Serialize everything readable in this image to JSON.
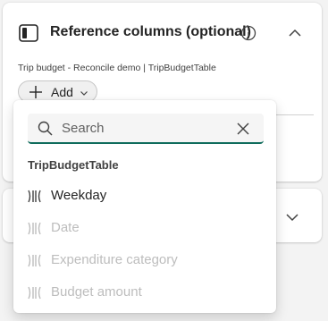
{
  "section": {
    "title": "Reference columns (optional)",
    "source_label": "Trip budget - Reconcile demo | TripBudgetTable",
    "add_button_label": "Add"
  },
  "dropdown": {
    "search_placeholder": "Search",
    "group_header": "TripBudgetTable",
    "options": [
      {
        "label": "Weekday",
        "enabled": true
      },
      {
        "label": "Date",
        "enabled": false
      },
      {
        "label": "Expenditure category",
        "enabled": false
      },
      {
        "label": "Budget amount",
        "enabled": false
      }
    ]
  },
  "colors": {
    "accent": "#0f6c5c",
    "text": "#242424",
    "disabled_text": "#bdbdbd",
    "background": "#f3f3f3"
  },
  "icons": {
    "header": "panel-left-icon",
    "info": "info-icon",
    "collapse": "chevron-up-icon",
    "expand": "chevron-down-icon",
    "add": "plus-icon",
    "search": "search-icon",
    "clear": "dismiss-icon",
    "column": "column-icon"
  }
}
